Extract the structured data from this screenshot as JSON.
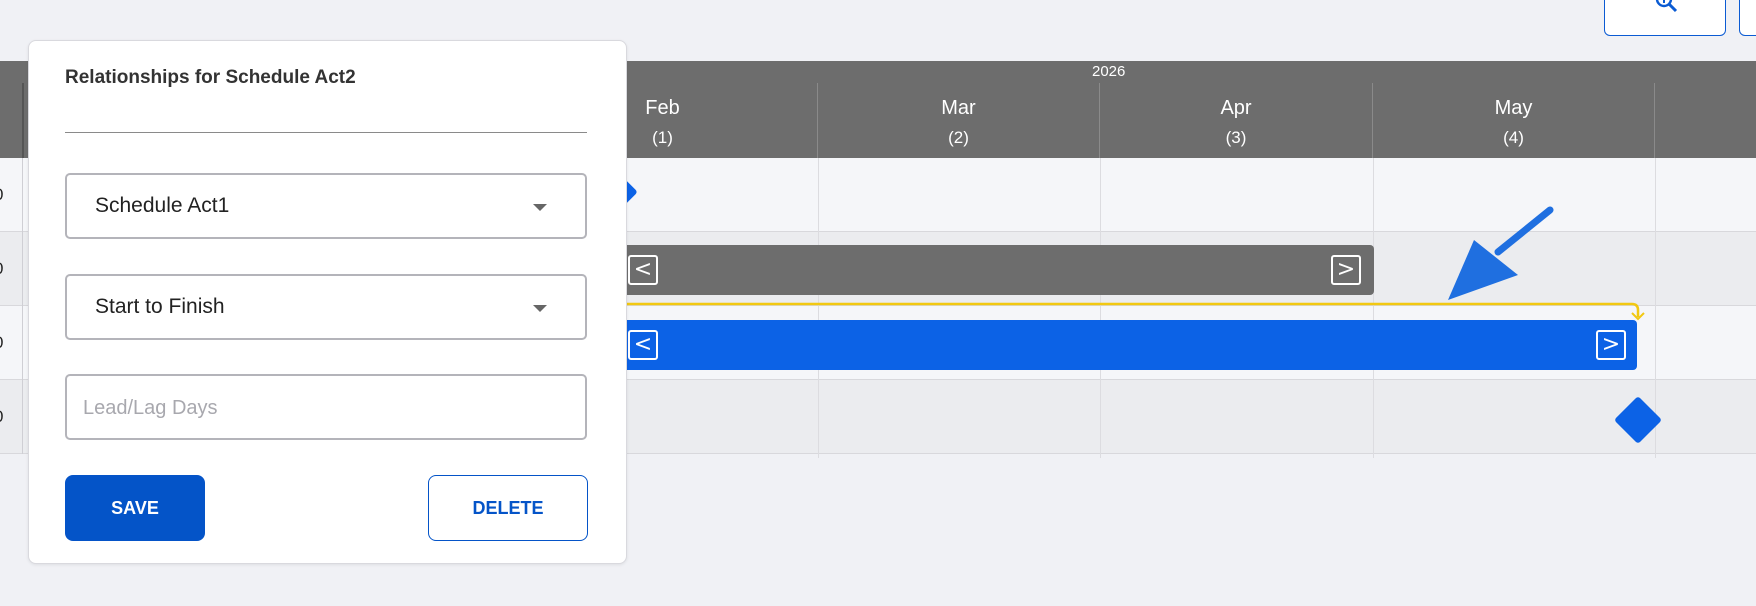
{
  "toolbar": {
    "zoom_icon": "zoom-in-icon"
  },
  "gantt": {
    "year": "2026",
    "months": [
      {
        "name": "Feb",
        "index": "(1)"
      },
      {
        "name": "Mar",
        "index": "(2)"
      },
      {
        "name": "Apr",
        "index": "(3)"
      },
      {
        "name": "May",
        "index": "(4)"
      }
    ],
    "row_numbers": [
      "0",
      "0",
      "0",
      "0"
    ],
    "link_color": "#f2c811",
    "bar_color": "#0c62e6",
    "gray_bar_color": "#6d6d6d",
    "annotation_arrow_color": "#1f6fe0"
  },
  "popup": {
    "title": "Relationships for Schedule Act2",
    "predecessor_value": "Schedule Act1",
    "relationship_value": "Start to Finish",
    "lead_lag_placeholder": "Lead/Lag Days",
    "lead_lag_value": "",
    "save_label": "SAVE",
    "delete_label": "DELETE"
  }
}
